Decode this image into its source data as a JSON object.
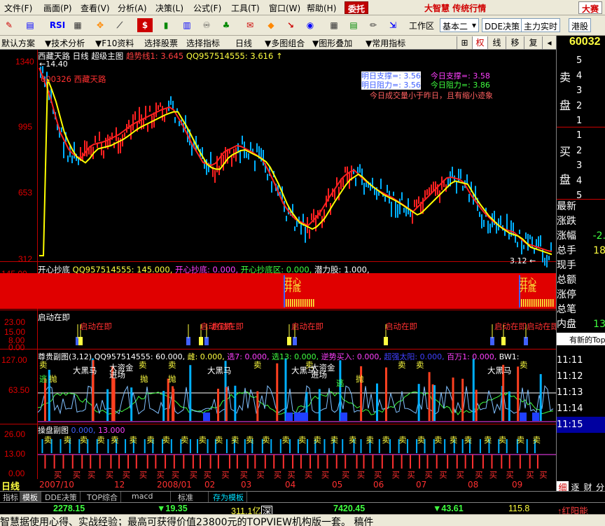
{
  "menubar": {
    "items": [
      "文件(F)",
      "画面(P)",
      "查看(V)",
      "分析(A)",
      "决策(L)",
      "公式(F)",
      "工具(T)",
      "窗口(W)",
      "帮助(H)"
    ],
    "entrust": "委托",
    "brand": "大智慧",
    "brand_sub": "传统行情",
    "mode": "大赛"
  },
  "toolbar": {
    "workarea_label": "工作区",
    "workarea_value": "基本二",
    "dde_button": "DDE决策",
    "main_button": "主力实时",
    "hk_button": "港股"
  },
  "funcbar": {
    "items": [
      "默认方案",
      "技术分析",
      "F10资料",
      "选择股票",
      "选择指标",
      "日线",
      "多图组合",
      "图形叠加",
      "常用指标"
    ],
    "tabs": [
      "权",
      "线",
      "移",
      "复"
    ],
    "stock_code": "60032"
  },
  "main_panel": {
    "title": "西藏天路",
    "period": "日线",
    "mode": "超级主图",
    "trend_label": "趋势线1: 3.645",
    "qq_label": "QQ957514555: 3.616",
    "arrow": "↑",
    "top_price": "1340",
    "top_value": "14.40",
    "stock_tag": "600326 西藏天路",
    "support_tomorrow": "明日支撑=: 3.56",
    "support_today": "今日支撑=: 3.58",
    "resist_tomorrow": "明日阻力=: 3.56",
    "resist_today": "今日阻力=: 3.86",
    "volume_note": "今日成交量小于昨日，且有缩小迹象",
    "last_price": "3.12",
    "y_labels": [
      "1340",
      "995",
      "653",
      "312"
    ]
  },
  "panel2": {
    "title": "开心抄底",
    "qq": "QQ957514555: 145.000,",
    "kaixin": "开心抄底: 0.000,",
    "zone": "开心抄底区: 0.000,",
    "potential": "潜力股: 1.000,",
    "y_top": "145.00",
    "marker": "开心",
    "marker2": "开底"
  },
  "panel3": {
    "title": "启动在即",
    "marker": "启动在即",
    "y_labels": [
      "23.00",
      "15.00",
      "8.00",
      "0.00"
    ]
  },
  "panel4": {
    "title": "尊贵副图(3,12)",
    "qq": "QQ957514555: 60.000,",
    "xiong": "雌: 0.000,",
    "xuan7": "选7: 0.000,",
    "xuan13": "选13: 0.000,",
    "nishi": "逆势买入: 0.000,",
    "big": "超强太阳: 0.000,",
    "bw": "百万1: 0.000,",
    "bw1": "BW1:",
    "y_labels": [
      "127.00",
      "63.50"
    ],
    "labels": {
      "sell": "卖",
      "escape": "逃",
      "throw": "抛",
      "horse": "大黑马",
      "gold": "大资金",
      "enter": "进场"
    }
  },
  "panel5": {
    "title": "操盘副图",
    "val1": "0.000,",
    "val2": "13.000",
    "y_labels": [
      "26.00",
      "13.00",
      "0.00"
    ],
    "sell": "卖",
    "buy": "买"
  },
  "dates": [
    "2007/10",
    "12",
    "2008/01",
    "02",
    "03",
    "04",
    "05",
    "06",
    "07",
    "08",
    "09"
  ],
  "day_label": "日线",
  "right_panel": {
    "sell_title": "卖",
    "sell_title2": "盘",
    "buy_title": "买",
    "buy_title2": "盘",
    "levels_sell": [
      "5",
      "4",
      "3",
      "2",
      "1"
    ],
    "levels_buy": [
      "1",
      "2",
      "3",
      "4",
      "5"
    ],
    "stats": [
      "最新",
      "涨跌",
      "涨幅",
      "总手",
      "现手",
      "总额",
      "涨停",
      "总笔",
      "内盘"
    ],
    "stat_values": [
      "",
      "",
      "-2.",
      "18",
      "",
      "",
      "",
      "",
      "13"
    ],
    "news_button": "有新的Top",
    "times": [
      "11:11",
      "11:12",
      "11:13",
      "11:14",
      "11:15",
      "11:15"
    ],
    "bottom_tabs": [
      "细",
      "逐",
      "财",
      "分"
    ]
  },
  "tabs": [
    "指标",
    "模板",
    "DDE决策",
    "TOP综合",
    "macd",
    "标准",
    "存为模板"
  ],
  "status": {
    "sh_index": "2278.15",
    "sh_change": "19.35",
    "sh_amount": "311.1亿",
    "sz_label": "深",
    "sz_index": "7420.45",
    "sz_change": "43.61",
    "sz_amount": "115.8",
    "right_text": "红阳能"
  },
  "ticker": "智慧据使用心得、实战经验；最高可获得价值23800元的TOPVIEW机构版一套。 稿件"
}
